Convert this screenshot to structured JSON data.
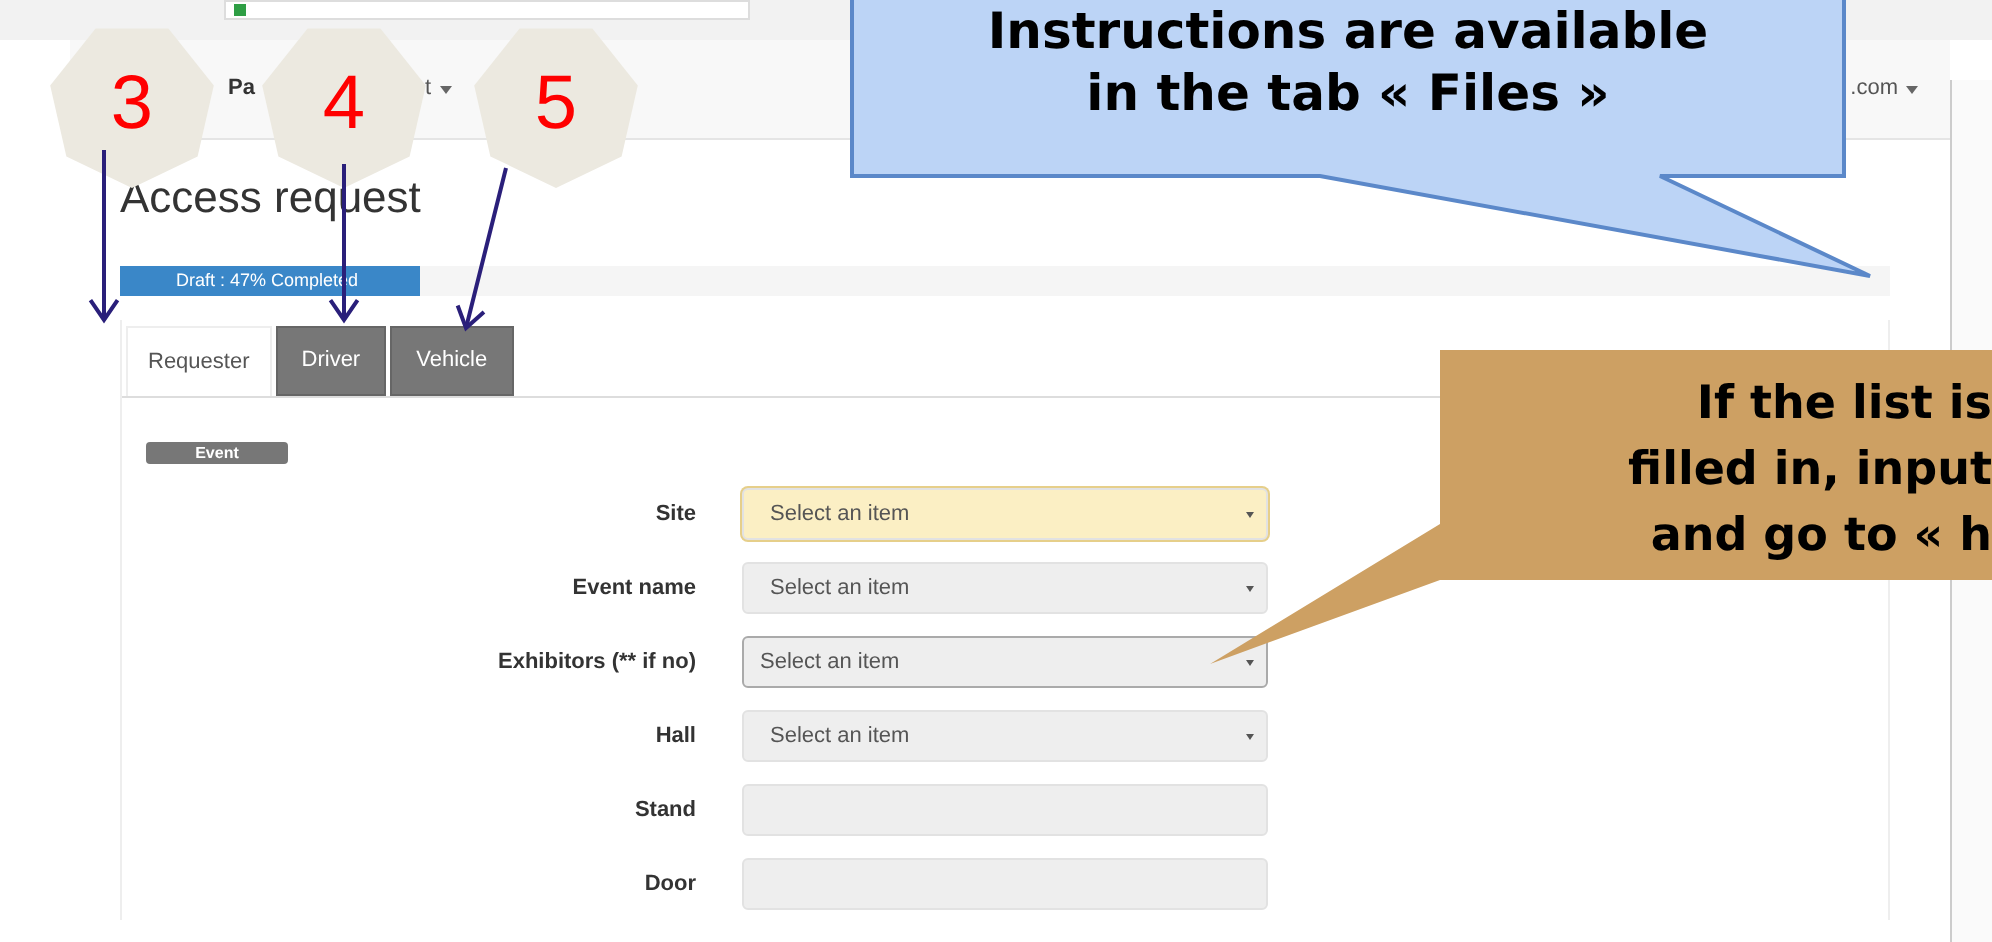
{
  "navbar": {
    "brand": "Pa",
    "menu": "t",
    "account": ".com"
  },
  "page_title": "Access request",
  "progress": {
    "label": "Draft : 47% Completed",
    "level": 0.17
  },
  "tabs": [
    {
      "label": "Requester",
      "selected": true
    },
    {
      "label": "Driver",
      "selected": false
    },
    {
      "label": "Vehicle",
      "selected": false
    }
  ],
  "section": "Event",
  "fields": [
    {
      "label": "Site",
      "kind": "select",
      "placeholder": "Select an item",
      "highlighted": true,
      "focused": false
    },
    {
      "label": "Event name",
      "kind": "select",
      "placeholder": "Select an item",
      "highlighted": false,
      "focused": false
    },
    {
      "label": "Exhibitors (** if no)",
      "kind": "select",
      "placeholder": "Select an item",
      "highlighted": false,
      "focused": true
    },
    {
      "label": "Hall",
      "kind": "select",
      "placeholder": "Select an item",
      "highlighted": false,
      "focused": false
    },
    {
      "label": "Stand",
      "kind": "text",
      "highlighted": false,
      "focused": false
    },
    {
      "label": "Door",
      "kind": "text",
      "highlighted": false,
      "focused": false
    }
  ],
  "annotations": {
    "badges": [
      "3",
      "4",
      "5"
    ],
    "callouts": [
      {
        "kind": "info",
        "lines": [
          "Instructions are available",
          "in the tab « Files »"
        ]
      },
      {
        "kind": "hint",
        "lines": [
          "If the list is",
          "filled in, input",
          "and go to « h"
        ]
      }
    ]
  }
}
